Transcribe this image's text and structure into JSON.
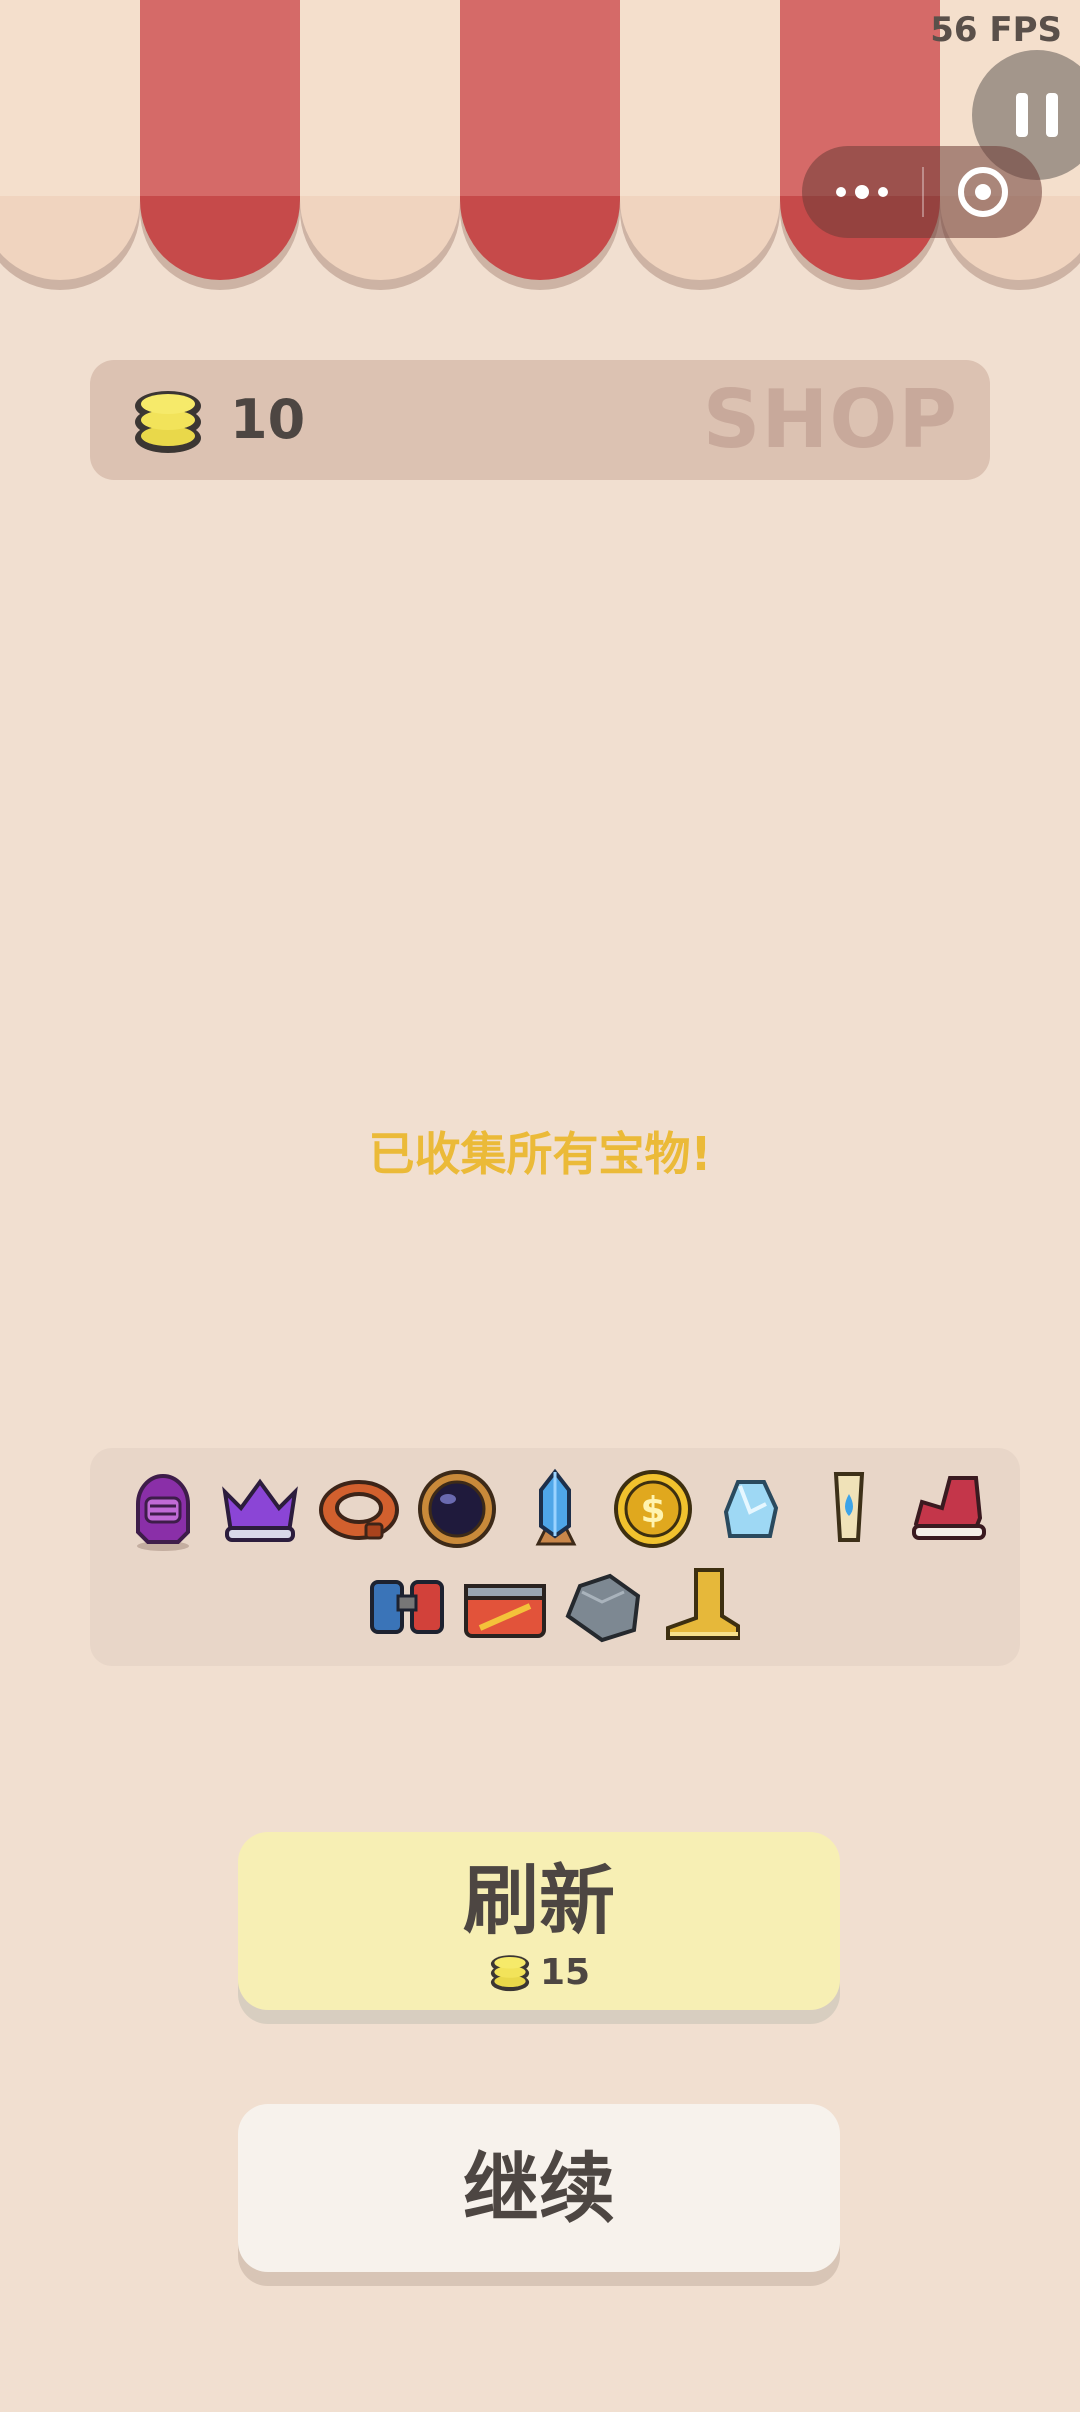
{
  "overlay": {
    "fps": "56 FPS"
  },
  "coin_bar": {
    "coins": "10",
    "shop_label": "SHOP"
  },
  "message": "已收集所有宝物!",
  "collected_items": [
    "knight-helmet-icon",
    "purple-crown-icon",
    "bronze-ring-icon",
    "dark-orb-icon",
    "blue-crystal-icon",
    "gold-coin-icon",
    "ice-block-icon",
    "potion-vial-icon",
    "red-sneaker-icon",
    "binoculars-icon",
    "battery-icon",
    "stone-icon",
    "golden-boot-icon"
  ],
  "buttons": {
    "refresh_label": "刷新",
    "refresh_cost": "15",
    "continue_label": "继续"
  },
  "colors": {
    "background": "#f1dfd0",
    "awning_red": "#d56a68",
    "message": "#ebba38",
    "refresh_button": "#f7efb4"
  }
}
